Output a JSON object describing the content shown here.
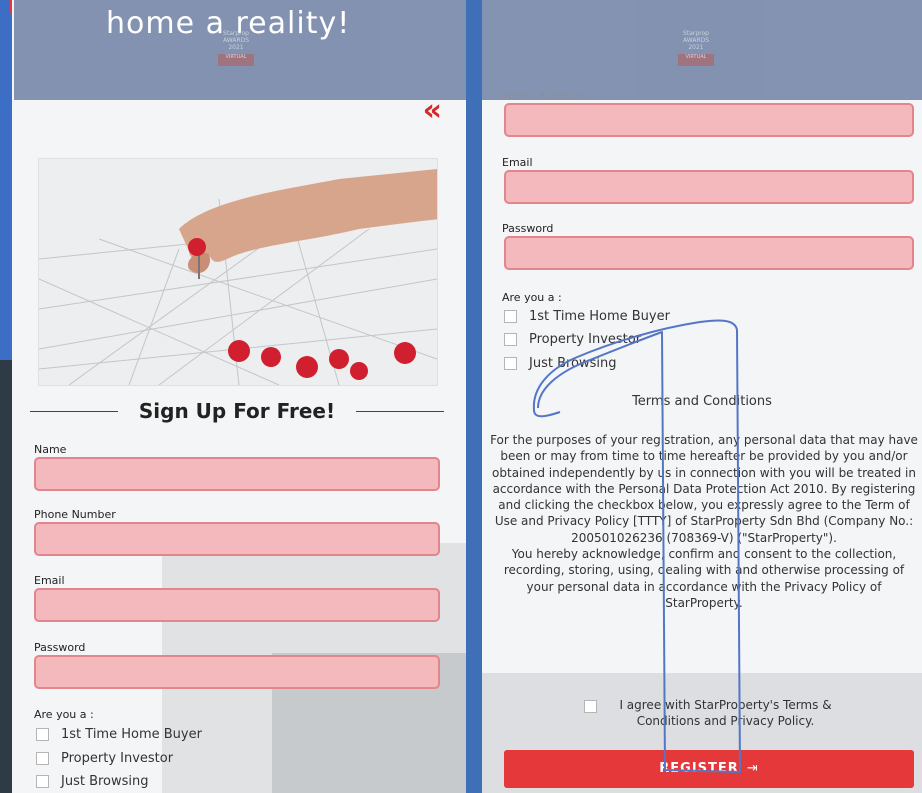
{
  "banner": {
    "left_text": "home a reality!",
    "awards_line1": "Starprop",
    "awards_line2": "AWARDS",
    "awards_year": "2021",
    "awards_badge": "VIRTUAL"
  },
  "left_form": {
    "heading": "Sign Up For Free!",
    "name_label": "Name",
    "name_value": "",
    "phone_label": "Phone Number",
    "phone_value": "",
    "email_label": "Email",
    "email_value": "",
    "password_label": "Password",
    "password_value": "",
    "are_you_label": "Are you a :",
    "options": [
      "1st Time Home Buyer",
      "Property Investor",
      "Just Browsing"
    ]
  },
  "right_form": {
    "phone_label": "Phone Number",
    "email_label": "Email",
    "password_label": "Password",
    "are_you_label": "Are you a :",
    "options": [
      "1st Time Home Buyer",
      "Property Investor",
      "Just Browsing"
    ],
    "terms_title": "Terms and Conditions",
    "terms_para1": "For the purposes of your registration, any personal data that may have been or may from time to time hereafter be provided by you and/or obtained independently by us in connection with you will be treated in accordance with the Personal Data Protection Act 2010. By registering and clicking the checkbox below, you expressly agree to the  Term of Use and Privacy Policy [TTTY] of StarProperty Sdn Bhd (Company No.: 200501026236 (708369-V) (\"StarProperty\").",
    "terms_para2": "You hereby acknowledge, confirm and consent to the collection, recording, storing, using, dealing with and otherwise processing of your personal data in accordance with the Privacy Policy of StarProperty.",
    "agree_text": "I agree with StarProperty's Terms & Conditions and Privacy Policy.",
    "register_label": "REGISTER",
    "register_icon": "login-icon"
  },
  "colors": {
    "input_fill": "#f3b9bd",
    "input_border": "#e3858c",
    "accent_red": "#e5383b",
    "banner_overlay": "#7f8fae",
    "annotation_blue": "#5576c7"
  }
}
